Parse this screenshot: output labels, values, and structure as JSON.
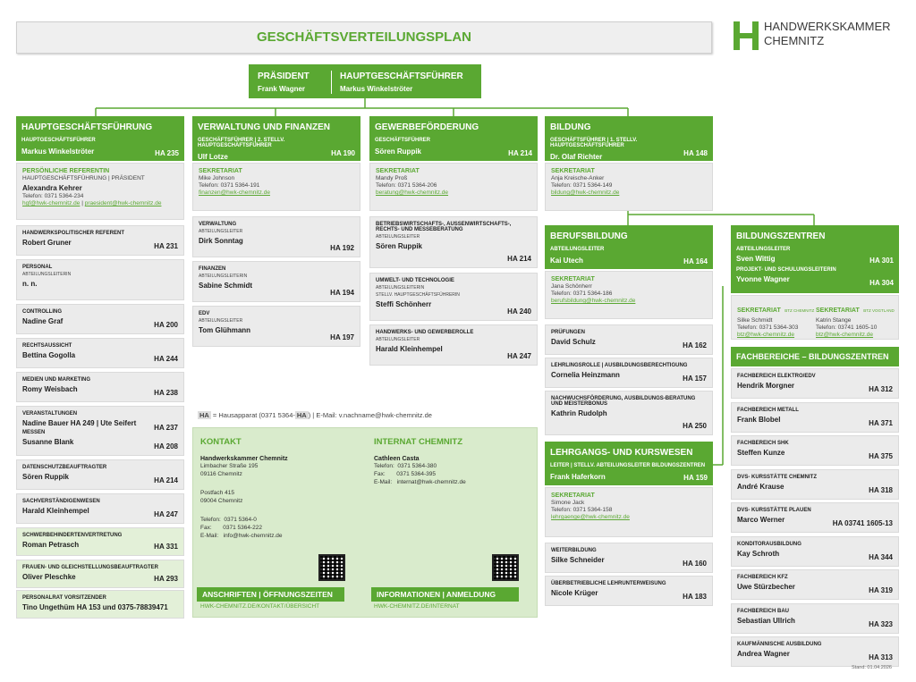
{
  "title": "GESCHÄFTSVERTEILUNGSPLAN",
  "logo": {
    "line1": "HANDWERKSKAMMER",
    "line2": "CHEMNITZ",
    "icon": "hwk-logo-icon"
  },
  "top": {
    "praesident_label": "PRÄSIDENT",
    "praesident_name": "Frank Wagner",
    "hgf_label": "HAUPTGESCHÄFTSFÜHRER",
    "hgf_name": "Markus Winkelströter"
  },
  "col1": {
    "head": {
      "title": "HAUPTGESCHÄFTSFÜHRUNG",
      "sub": "HAUPTGESCHÄFTSFÜHRER",
      "name": "Markus Winkelströter",
      "ha": "HA 235"
    },
    "referent": {
      "cat": "PERSÖNLICHE REFERENTIN",
      "sub": "HAUPTGESCHÄFTSFÜHRUNG | PRÄSIDENT",
      "name": "Alexandra Kehrer",
      "tel": "Telefon: 0371 5364-234",
      "mail1": "hgf@hwk-chemnitz.de",
      "sep": " | ",
      "mail2": "praesident@hwk-chemnitz.de"
    },
    "rows": [
      {
        "cat": "HANDWERKSPOLITISCHER REFERENT",
        "name": "Robert Gruner",
        "ha": "HA 231"
      },
      {
        "cat": "PERSONAL",
        "sub": "ABTEILUNGSLEITERIN",
        "name": "n. n.",
        "ha": ""
      },
      {
        "cat": "CONTROLLING",
        "name": "Nadine Graf",
        "ha": "HA 200"
      },
      {
        "cat": "RECHTSAUSSICHT",
        "name": "Bettina Gogolla",
        "ha": "HA 244"
      },
      {
        "cat": "MEDIEN UND MARKETING",
        "name": "Romy Weisbach",
        "ha": "HA 238"
      },
      {
        "cat": "VERANSTALTUNGEN",
        "name": "Nadine Bauer HA 249 | Ute Seifert",
        "ha": "HA 237",
        "cat2": "MESSEN",
        "name2": "Susanne Blank",
        "ha2": "HA 208"
      },
      {
        "cat": "DATENSCHUTZBEAUFTRAGTER",
        "name": "Sören Ruppik",
        "ha": "HA 214"
      },
      {
        "cat": "SACHVERSTÄNDIGENWESEN",
        "name": "Harald Kleinhempel",
        "ha": "HA 247"
      }
    ],
    "green_rows": [
      {
        "cat": "SCHWERBEHINDERTENVERTRETUNG",
        "name": "Roman Petrasch",
        "ha": "HA 331"
      },
      {
        "cat": "FRAUEN- UND GLEICHSTELLUNGSBEAUFTRAGTER",
        "name": "Oliver Pleschke",
        "ha": "HA 293"
      },
      {
        "cat": "PERSONALRAT VORSITZENDER",
        "name": "Tino Ungethüm  HA 153 und 0375-78839471",
        "ha": ""
      }
    ]
  },
  "col2": {
    "head": {
      "title": "VERWALTUNG UND FINANZEN",
      "sub": "GESCHÄFTSFÜHRER | 2. STELLV. HAUPTGESCHÄFTSFÜHRER",
      "name": "Ulf Lotze",
      "ha": "HA 190"
    },
    "sekretariat": {
      "cat": "SEKRETARIAT",
      "name": "Mike Johnson",
      "tel": "Telefon: 0371 5364-191",
      "mail": "finanzen@hwk-chemnitz.de"
    },
    "rows": [
      {
        "cat": "VERWALTUNG",
        "sub": "ABTEILUNGSLEITER",
        "name": "Dirk Sonntag",
        "ha": "HA 192"
      },
      {
        "cat": "FINANZEN",
        "sub": "ABTEILUNGSLEITERIN",
        "name": "Sabine Schmidt",
        "ha": "HA 194"
      },
      {
        "cat": "EDV",
        "sub": "ABTEILUNGSLEITER",
        "name": "Tom Glühmann",
        "ha": "HA 197"
      }
    ]
  },
  "col3": {
    "head": {
      "title": "GEWERBEFÖRDERUNG",
      "sub": "GESCHÄFTSFÜHRER",
      "name": "Sören Ruppik",
      "ha": "HA 214"
    },
    "sekretariat": {
      "cat": "SEKRETARIAT",
      "name": "Mandy Proß",
      "tel": "Telefon: 0371 5364-206",
      "mail": "beratung@hwk-chemnitz.de"
    },
    "rows": [
      {
        "cat": "BETRIEBSWIRTSCHAFTS-, AUßENWIRTSCHAFTS-, RECHTS- UND MESSEBERATUNG",
        "sub": "ABTEILUNGSLEITER",
        "name": "Sören Ruppik",
        "ha": "HA 214"
      },
      {
        "cat": "UMWELT- UND TECHNOLOGIE",
        "sub": "ABTEILUNGSLEITERIN",
        "sub2": "STELLV. HAUPTGESCHÄFTSFÜHRERIN",
        "name": "Steffi Schönherr",
        "ha": "HA 240"
      },
      {
        "cat": "HANDWERKS- UND GEWERBEROLLE",
        "sub": "ABTEILUNGSLEITER",
        "name": "Harald Kleinhempel",
        "ha": "HA 247"
      }
    ]
  },
  "col4": {
    "head": {
      "title": "BILDUNG",
      "sub": "GESCHÄFTSFÜHRER | 1. STELLV. HAUPTGESCHÄFTSFÜHRER",
      "name": "Dr. Olaf Richter",
      "ha": "HA 148"
    },
    "sekretariat": {
      "cat": "SEKRETARIAT",
      "name": "Anja Kreische-Anker",
      "tel": "Telefon: 0371 5364-149",
      "mail": "bildung@hwk-chemnitz.de"
    },
    "berufsbildung": {
      "title": "BERUFSBILDUNG",
      "sub": "ABTEILUNGSLEITER",
      "name": "Kai Utech",
      "ha": "HA 164"
    },
    "bb_sek": {
      "cat": "SEKRETARIAT",
      "name": "Jana Schönherr",
      "tel": "Telefon: 0371 5364-186",
      "mail": "berufsbildung@hwk-chemnitz.de"
    },
    "bb_rows": [
      {
        "cat": "PRÜFUNGEN",
        "name": "David Schulz",
        "ha": "HA 162"
      },
      {
        "cat": "LEHRLINGSROLLE | AUSBILDUNGSBERECHTIGUNG",
        "name": "Cornelia Heinzmann",
        "ha": "HA 157"
      },
      {
        "cat": "NACHWUCHSFÖRDERUNG, AUSBILDUNGS-BERATUNG UND MEISTERBONUS",
        "name": "Kathrin Rudolph",
        "ha": "HA 250"
      }
    ],
    "lehrgang": {
      "title": "LEHRGANGS- UND KURSWESEN",
      "sub": "LEITER | STELLV. ABTEILUNGSLEITER BILDUNGSZENTREN",
      "name": "Frank Haferkorn",
      "ha": "HA 159"
    },
    "lk_sek": {
      "cat": "SEKRETARIAT",
      "name": "Simone Jack",
      "tel": "Telefon: 0371 5364-158",
      "mail": "lehrgaenge@hwk-chemnitz.de"
    },
    "lk_rows": [
      {
        "cat": "WEITERBILDUNG",
        "name": "Silke Schneider",
        "ha": "HA 160"
      },
      {
        "cat": "ÜBERBETRIEBLICHE LEHRUNTERWEISUNG",
        "name": "Nicole Krüger",
        "ha": "HA 183"
      }
    ]
  },
  "col5": {
    "head": {
      "title": "BILDUNGSZENTREN",
      "sub": "ABTEILUNGSLEITER",
      "name": "Sven Wittig",
      "ha": "HA 301",
      "sub2": "PROJEKT- UND SCHULUNGSLEITERIN",
      "name2": "Yvonne Wagner",
      "ha2": "HA 304"
    },
    "sek1": {
      "cat": "SEKRETARIAT",
      "tag": "BTZ CHEMNITZ",
      "name": "Silke Schmidt",
      "tel": "Telefon: 0371 5364-303",
      "mail": "btz@hwk-chemnitz.de"
    },
    "sek2": {
      "cat": "SEKRETARIAT",
      "tag": "BTZ VOGTLAND",
      "name": "Katrin Stange",
      "tel": "Telefon: 03741 1605-10",
      "mail": "btz@hwk-chemnitz.de"
    },
    "fb_title": "FACHBEREICHE – BILDUNGSZENTREN",
    "rows": [
      {
        "cat": "FACHBEREICH ELEKTRO/EDV",
        "name": "Hendrik Morgner",
        "ha": "HA 312"
      },
      {
        "cat": "FACHBEREICH METALL",
        "name": "Frank Blobel",
        "ha": "HA 371"
      },
      {
        "cat": "FACHBEREICH SHK",
        "name": "Steffen Kunze",
        "ha": "HA 375"
      },
      {
        "cat": "DVS- KURSSTÄTTE CHEMNITZ",
        "name": "André Krause",
        "ha": "HA 318"
      },
      {
        "cat": "DVS- KURSSTÄTTE PLAUEN",
        "name": "Marco Werner",
        "ha": "HA 03741 1605-13"
      },
      {
        "cat": "KONDITORAUSBILDUNG",
        "name": "Kay Schroth",
        "ha": "HA 344"
      },
      {
        "cat": "FACHBEREICH KFZ",
        "name": "Uwe Stürzbecher",
        "ha": "HA 319"
      },
      {
        "cat": "FACHBEREICH BAU",
        "name": "Sebastian Ullrich",
        "ha": "HA 323"
      },
      {
        "cat": "KAUFMÄNNISCHE AUSBILDUNG",
        "name": "Andrea Wagner",
        "ha": "HA 313"
      }
    ]
  },
  "legend": {
    "ha1": "HA",
    "mid": " = Hausapparat (0371 5364-",
    "ha2": "HA",
    "rest": ") | E-Mail: v.nachname@hwk-chemnitz.de"
  },
  "contact": {
    "kontakt_title": "KONTAKT",
    "kontakt_org": "Handwerkskammer Chemnitz",
    "kontakt_addr1": "Limbacher Straße 195",
    "kontakt_addr2": "09116 Chemnitz",
    "kontakt_post1": "Postfach 415",
    "kontakt_post2": "09004 Chemnitz",
    "kontakt_tel": "Telefon:  0371 5364-0",
    "kontakt_fax": "Fax:       0371 5364-222",
    "kontakt_mail": "E-Mail:   info@hwk-chemnitz.de",
    "kontakt_bar": "ANSCHRIFTEN | ÖFFNUNGSZEITEN",
    "kontakt_link": "HWK-CHEMNITZ.DE/KONTAKT/ÜBERSICHT",
    "internat_title": "INTERNAT CHEMNITZ",
    "internat_name": "Cathleen Casta",
    "internat_tel": "Telefon:  0371 5364-380",
    "internat_fax": "Fax:       0371 5364-395",
    "internat_mail": "E-Mail:   internat@hwk-chemnitz.de",
    "internat_bar": "INFORMATIONEN | ANMELDUNG",
    "internat_link": "HWK-CHEMNITZ.DE/INTERNAT"
  },
  "stand": "Stand: 01.04.2026",
  "colors": {
    "green": "#5aa832",
    "lightgreen": "#d9ebcc",
    "grey": "#ebebeb"
  }
}
